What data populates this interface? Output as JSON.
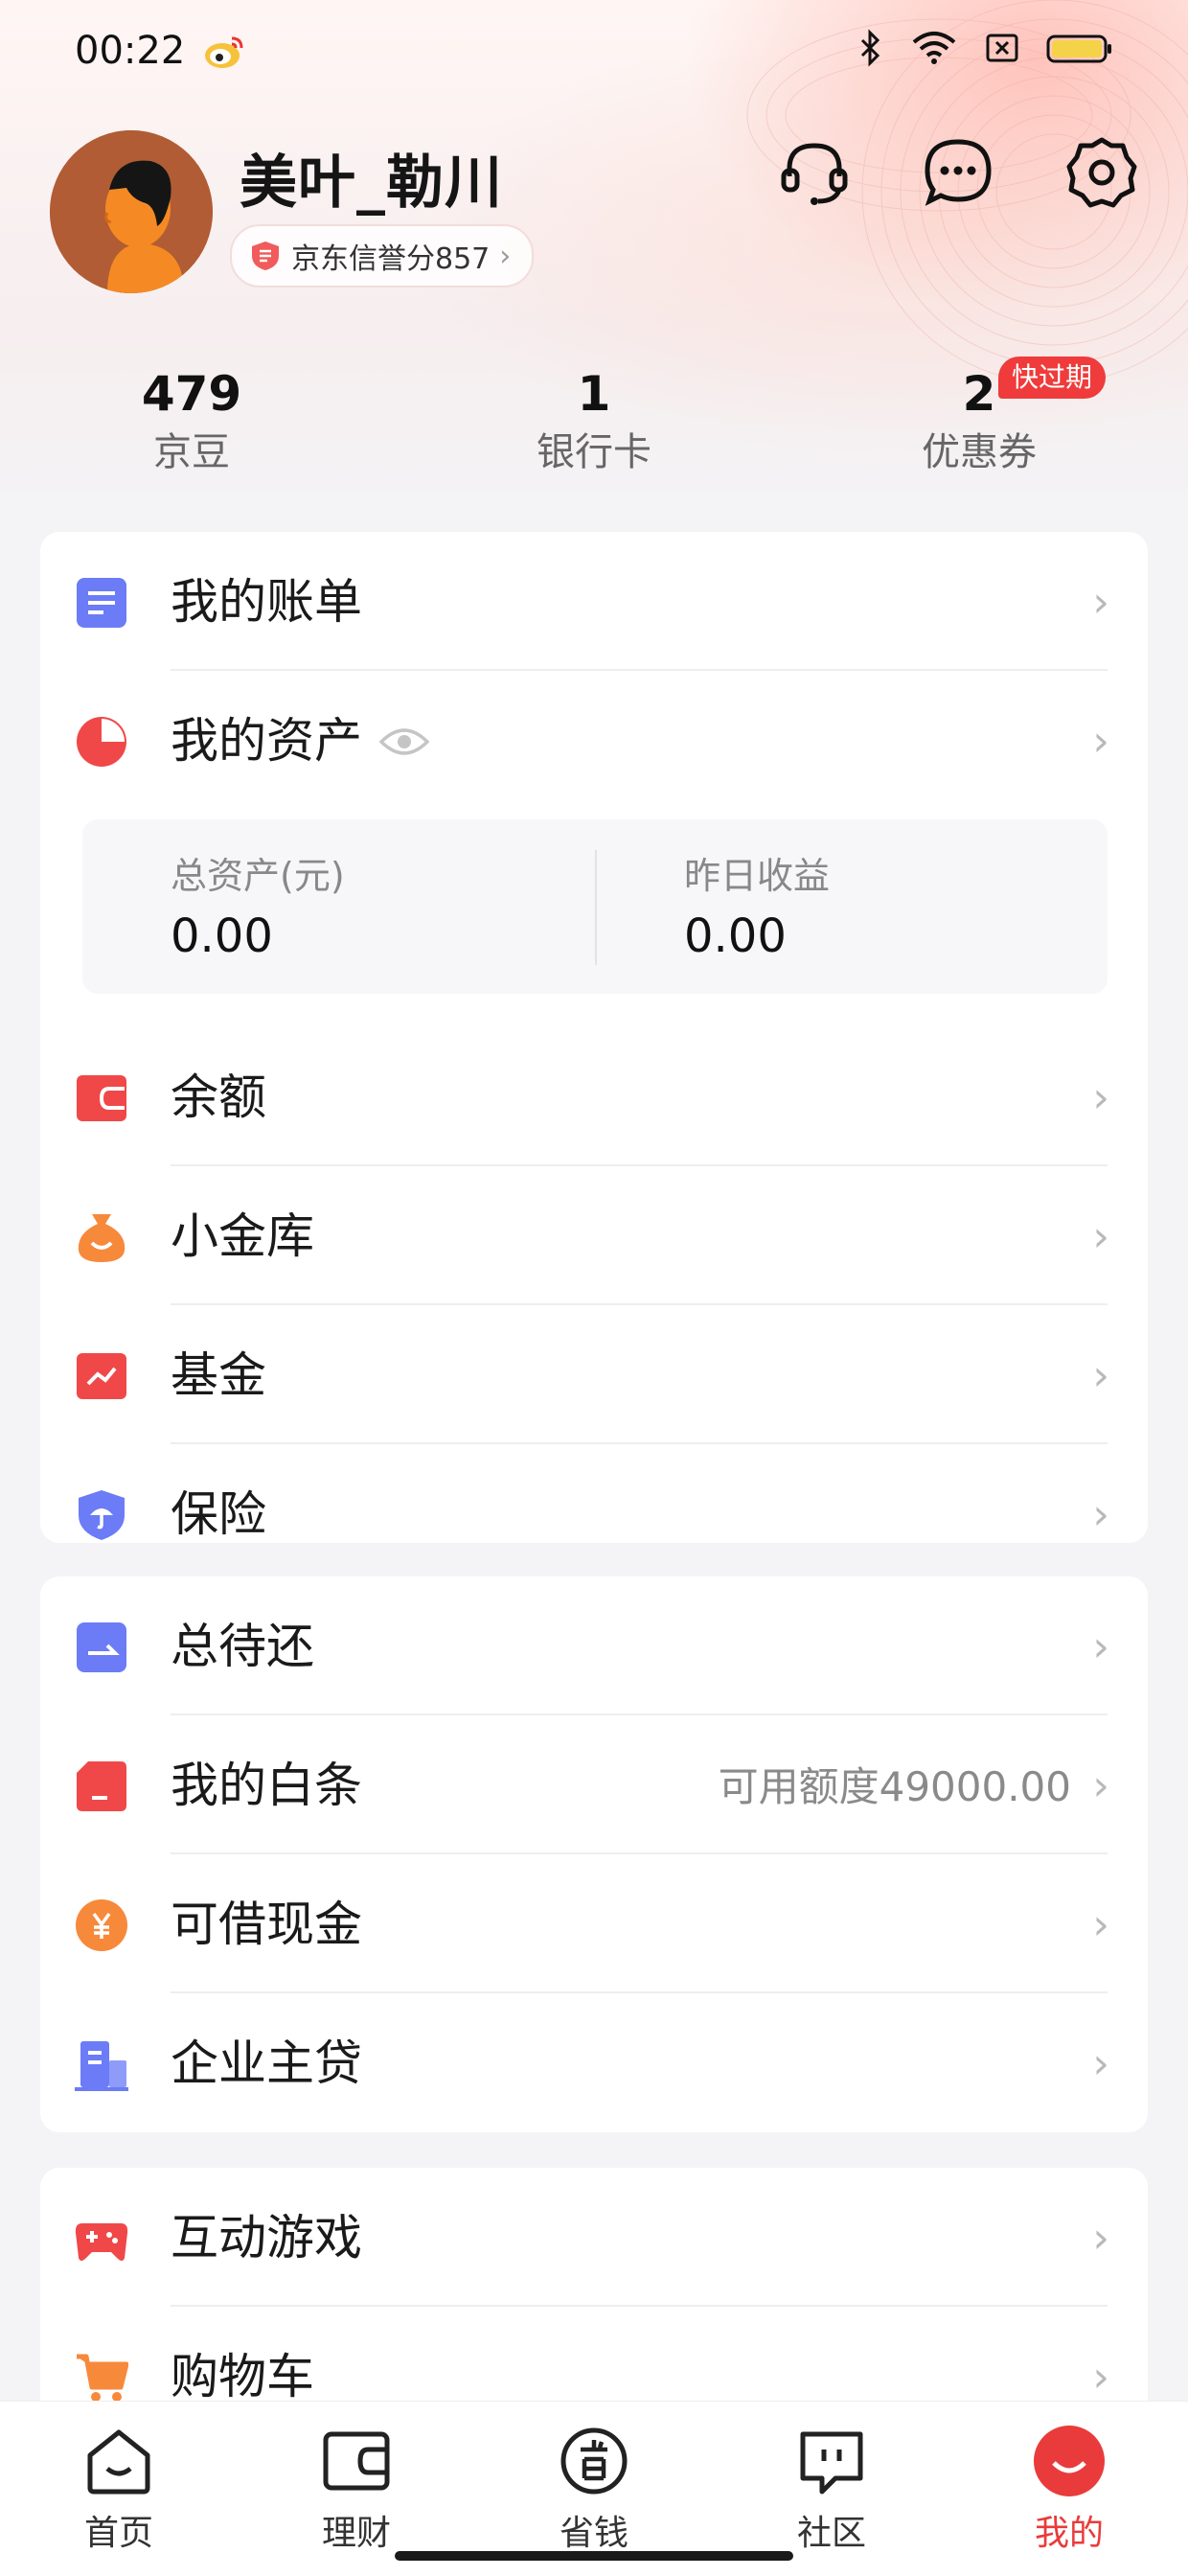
{
  "status_bar": {
    "time": "00:22"
  },
  "profile": {
    "username": "美叶_勒川",
    "credit_badge": "京东信誉分857"
  },
  "stats": [
    {
      "value": "479",
      "label": "京豆"
    },
    {
      "value": "1",
      "label": "银行卡"
    },
    {
      "value": "2",
      "label": "优惠券",
      "badge": "快过期"
    }
  ],
  "card1": {
    "items": [
      {
        "label": "我的账单",
        "icon": "bill-icon"
      },
      {
        "label": "我的资产",
        "icon": "pie-chart-icon"
      },
      {
        "label": "余额",
        "icon": "wallet-icon"
      },
      {
        "label": "小金库",
        "icon": "money-bag-icon"
      },
      {
        "label": "基金",
        "icon": "trend-chart-icon"
      },
      {
        "label": "保险",
        "icon": "shield-umbrella-icon"
      }
    ],
    "assets": {
      "total_label": "总资产(元)",
      "total_value": "0.00",
      "yesterday_label": "昨日收益",
      "yesterday_value": "0.00"
    }
  },
  "card2": {
    "items": [
      {
        "label": "总待还",
        "icon": "repay-icon"
      },
      {
        "label": "我的白条",
        "icon": "card-icon",
        "sub": "可用额度49000.00"
      },
      {
        "label": "可借现金",
        "icon": "yuan-coin-icon"
      },
      {
        "label": "企业主贷",
        "icon": "building-icon"
      }
    ]
  },
  "card3": {
    "items": [
      {
        "label": "互动游戏",
        "icon": "gamepad-icon"
      },
      {
        "label": "购物车",
        "icon": "shopping-cart-icon"
      }
    ]
  },
  "tabs": [
    {
      "label": "首页",
      "icon": "home-icon"
    },
    {
      "label": "理财",
      "icon": "wallet-tab-icon"
    },
    {
      "label": "省钱",
      "icon": "coupon-tab-icon"
    },
    {
      "label": "社区",
      "icon": "chat-tab-icon"
    },
    {
      "label": "我的",
      "icon": "profile-tab-icon",
      "active": true
    }
  ],
  "colors": {
    "accent_red": "#e93b3b",
    "blue_icon": "#6b7cf6",
    "orange_icon": "#f7893b"
  }
}
